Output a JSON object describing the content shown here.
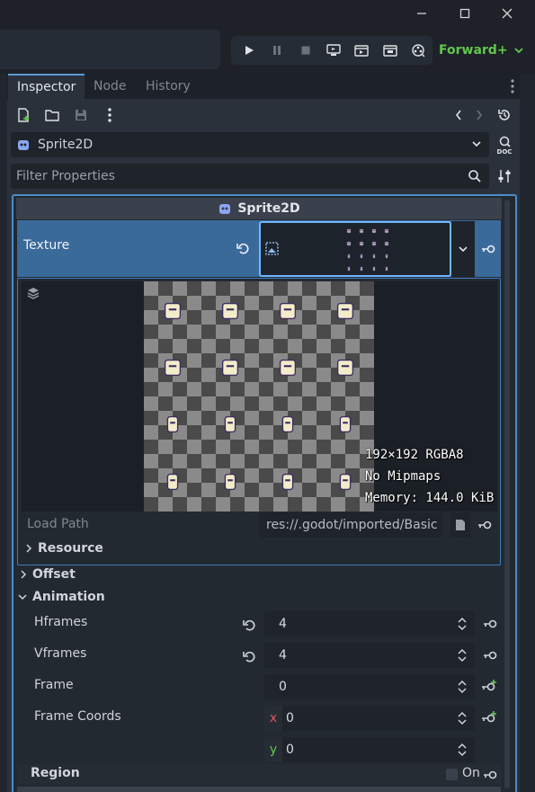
{
  "renderer": "Forward+",
  "tabs": [
    "Inspector",
    "Node",
    "History"
  ],
  "object_selector": "Sprite2D",
  "filter_placeholder": "Filter Properties",
  "category_title": "Sprite2D",
  "texture": {
    "label": "Texture",
    "info_size": "192×192 RGBA8",
    "info_mipmaps": "No Mipmaps",
    "info_memory": "Memory: 144.0 KiB",
    "load_path_label": "Load Path",
    "load_path_value": "res://.godot/imported/Basic",
    "resource_label": "Resource"
  },
  "sections": {
    "offset": "Offset",
    "animation": "Animation",
    "region": "Region"
  },
  "animation": {
    "hframes_label": "Hframes",
    "hframes": "4",
    "vframes_label": "Vframes",
    "vframes": "4",
    "frame_label": "Frame",
    "frame": "0",
    "frame_coords_label": "Frame Coords",
    "coord_x_label": "x",
    "coord_x": "0",
    "coord_y_label": "y",
    "coord_y": "0"
  },
  "region_toggle": "On",
  "colors": {
    "accent": "#4c8cc8",
    "selected_row": "#3a6a9a",
    "renderer": "#63c74d",
    "x_axis": "#e0565b",
    "y_axis": "#63c74d"
  }
}
